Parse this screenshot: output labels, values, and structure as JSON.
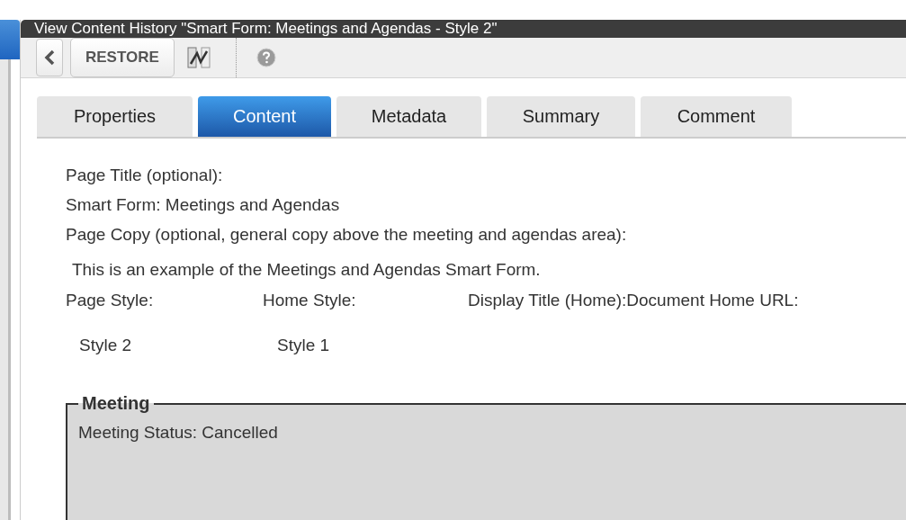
{
  "window": {
    "title": "View Content History \"Smart Form: Meetings and Agendas - Style 2\""
  },
  "toolbar": {
    "restore_label": "RESTORE"
  },
  "tabs": [
    {
      "label": "Properties",
      "selected": false
    },
    {
      "label": "Content",
      "selected": true
    },
    {
      "label": "Metadata",
      "selected": false
    },
    {
      "label": "Summary",
      "selected": false
    },
    {
      "label": "Comment",
      "selected": false
    }
  ],
  "content": {
    "lines": [
      {
        "text": "Page Title (optional):",
        "kind": "label"
      },
      {
        "text": "Smart Form: Meetings and Agendas",
        "kind": "label"
      },
      {
        "text": "Page Copy (optional, general copy above the meeting and agendas area):",
        "kind": "label"
      },
      {
        "text": "This is an example of the Meetings and Agendas Smart Form.",
        "kind": "value"
      }
    ],
    "style_labels": [
      "Page Style:",
      "Home Style:",
      "Display Title (Home):",
      "Document Home URL:"
    ],
    "style_values": [
      "Style 2",
      "Style 1"
    ],
    "meeting": {
      "legend": "Meeting",
      "status": "Meeting Status: Cancelled"
    }
  }
}
